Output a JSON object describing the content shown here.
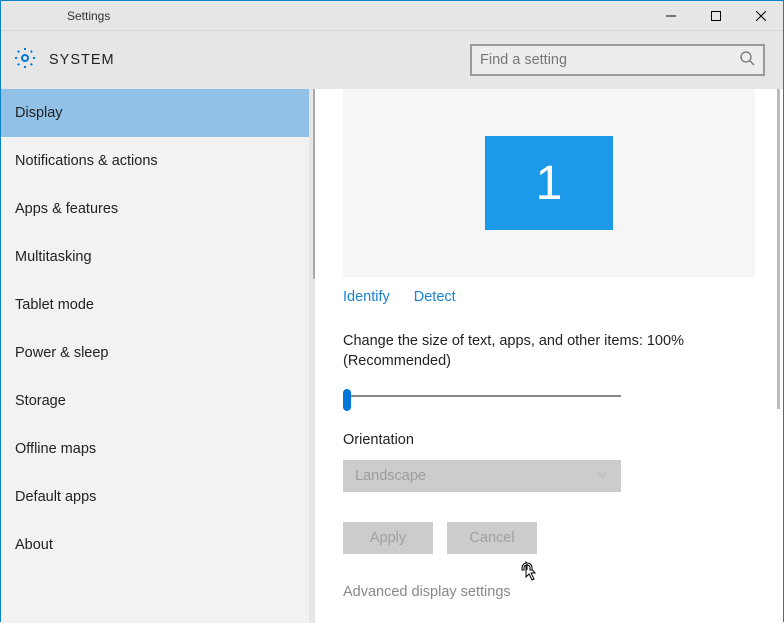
{
  "window": {
    "title": "Settings"
  },
  "header": {
    "system_label": "SYSTEM",
    "search_placeholder": "Find a setting"
  },
  "sidebar": {
    "items": [
      {
        "label": "Display",
        "selected": true
      },
      {
        "label": "Notifications & actions",
        "selected": false
      },
      {
        "label": "Apps & features",
        "selected": false
      },
      {
        "label": "Multitasking",
        "selected": false
      },
      {
        "label": "Tablet mode",
        "selected": false
      },
      {
        "label": "Power & sleep",
        "selected": false
      },
      {
        "label": "Storage",
        "selected": false
      },
      {
        "label": "Offline maps",
        "selected": false
      },
      {
        "label": "Default apps",
        "selected": false
      },
      {
        "label": "About",
        "selected": false
      }
    ]
  },
  "display": {
    "monitor_number": "1",
    "identify_label": "Identify",
    "detect_label": "Detect",
    "scale_text": "Change the size of text, apps, and other items: 100% (Recommended)",
    "orientation_label": "Orientation",
    "orientation_value": "Landscape",
    "apply_label": "Apply",
    "cancel_label": "Cancel",
    "advanced_link": "Advanced display settings"
  },
  "colors": {
    "accent": "#0078d7",
    "monitor_tile": "#1c99e8",
    "sidebar_selected": "#91c1e7"
  }
}
